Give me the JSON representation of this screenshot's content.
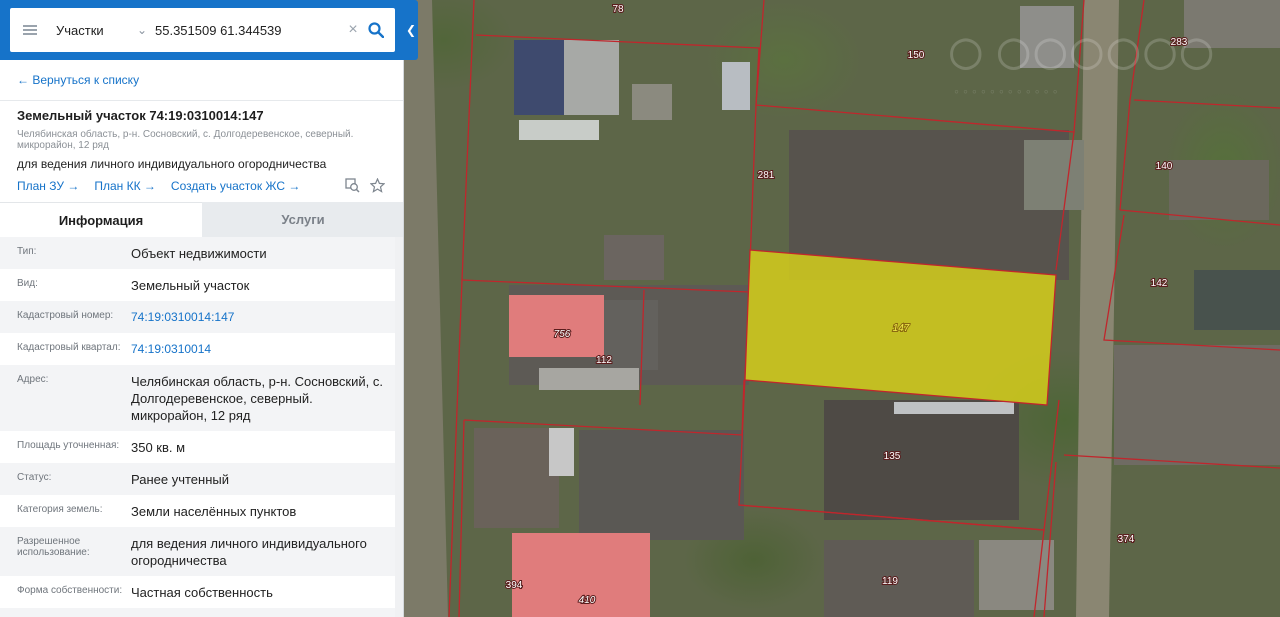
{
  "search": {
    "layer": "Участки",
    "query": "55.351509 61.344539"
  },
  "panel": {
    "back_link": "← Вернуться к списку",
    "title": "Земельный участок 74:19:0310014:147",
    "address_short": "Челябинская область, р-н. Сосновский, с. Долгодеревенское, северный. микрорайон, 12 ряд",
    "purpose": "для ведения личного индивидуального огородничества",
    "links": [
      "План ЗУ →",
      "План КК →",
      "Создать участок ЖС →"
    ],
    "tabs": [
      "Информация",
      "Услуги"
    ],
    "rows": [
      {
        "label": "Тип:",
        "value": "Объект недвижимости"
      },
      {
        "label": "Вид:",
        "value": "Земельный участок"
      },
      {
        "label": "Кадастровый номер:",
        "value": "74:19:0310014:147"
      },
      {
        "label": "Кадастровый квартал:",
        "value": "74:19:0310014"
      },
      {
        "label": "Адрес:",
        "value": "Челябинская область, р-н. Сосновский, с. Долгодеревенское, северный. микрорайон, 12 ряд"
      },
      {
        "label": "Площадь уточненная:",
        "value": "350 кв. м"
      },
      {
        "label": "Статус:",
        "value": "Ранее учтенный"
      },
      {
        "label": "Категория земель:",
        "value": "Земли населённых пунктов"
      },
      {
        "label": "Разрешенное использование:",
        "value": "для ведения личного индивидуального огородничества"
      },
      {
        "label": "Форма собственности:",
        "value": "Частная собственность"
      },
      {
        "label": "",
        "value": ""
      }
    ]
  },
  "map": {
    "parcel_labels": [
      "78",
      "150",
      "283",
      "281",
      "140",
      "142",
      "147",
      "756",
      "112",
      "135",
      "374",
      "394",
      "410",
      "119"
    ],
    "highlight_color": "#d9d21a",
    "boundary_color": "#c0262c"
  },
  "colors": {
    "accent": "#1673c9"
  }
}
